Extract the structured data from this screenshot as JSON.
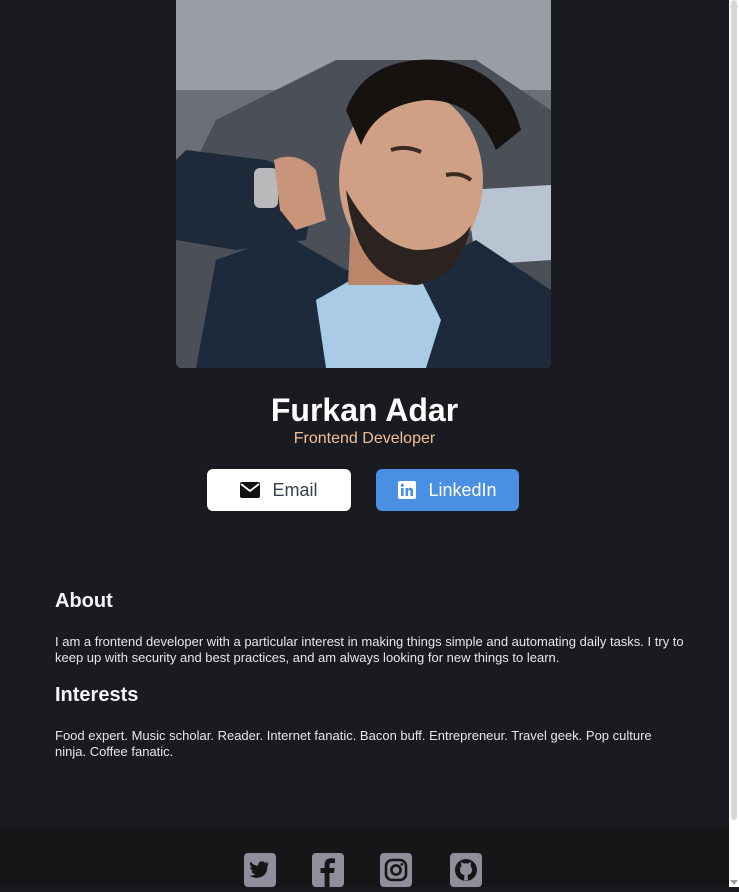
{
  "profile": {
    "photo_alt": "Furkan Adar profile photo",
    "name": "Furkan Adar",
    "role": "Frontend Developer"
  },
  "actions": {
    "email_label": "Email",
    "linkedin_label": "LinkedIn"
  },
  "about": {
    "title": "About",
    "text": "I am a frontend developer with a particular interest in making things simple and automating daily tasks. I try to keep up with security and best practices, and am always looking for new things to learn."
  },
  "interests": {
    "title": "Interests",
    "text": "Food expert. Music scholar. Reader. Internet fanatic. Bacon buff. Entrepreneur. Travel geek. Pop culture ninja. Coffee fanatic."
  },
  "footer": {
    "icons": [
      "twitter-icon",
      "facebook-icon",
      "instagram-icon",
      "github-icon"
    ]
  },
  "colors": {
    "background": "#1a1b21",
    "footer": "#161619",
    "accent_role": "#f3bf99",
    "linkedin_blue": "#4a90e2",
    "icon_gray": "#918e9b"
  }
}
